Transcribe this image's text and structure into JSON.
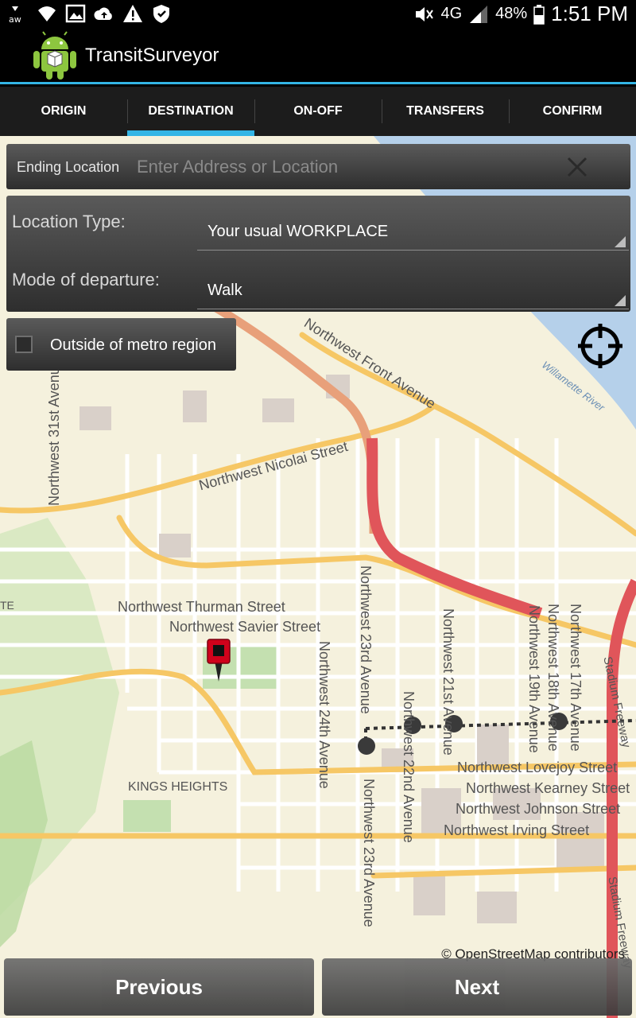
{
  "status_bar": {
    "network_label": "4G",
    "battery": "48%",
    "time": "1:51 PM"
  },
  "app": {
    "title": "TransitSurveyor"
  },
  "tabs": [
    {
      "label": "ORIGIN",
      "active": false
    },
    {
      "label": "DESTINATION",
      "active": true
    },
    {
      "label": "ON-OFF",
      "active": false
    },
    {
      "label": "TRANSFERS",
      "active": false
    },
    {
      "label": "CONFIRM",
      "active": false
    }
  ],
  "search": {
    "label": "Ending Location",
    "placeholder": "Enter Address or Location",
    "value": ""
  },
  "form": {
    "location_type_label": "Location Type:",
    "location_type_value": "Your usual WORKPLACE",
    "mode_label": "Mode of departure:",
    "mode_value": "Walk"
  },
  "metro_checkbox": {
    "label": "Outside of metro region",
    "checked": false
  },
  "map": {
    "labels": {
      "front_ave": "Northwest Front Avenue",
      "willamette": "Willamette River",
      "nw31": "Northwest 31st Avenue",
      "nicolai": "Northwest Nicolai Street",
      "thurman": "Northwest Thurman Street",
      "savier": "Northwest Savier Street",
      "nw24": "Northwest 24th Avenue",
      "nw23a": "Northwest 23rd Avenue",
      "nw23b": "Northwest 23rd Avenue",
      "nw22": "Northwest 22nd Avenue",
      "nw21": "Northwest 21st Avenue",
      "nw19": "Northwest 19th Avenue",
      "nw18": "Northwest 18th Avenue",
      "nw17": "Northwest 17th Avenue",
      "stadium1": "Stadium Freeway",
      "stadium2": "Stadium Freeway",
      "lovejoy": "Northwest Lovejoy Street",
      "kearney": "Northwest Kearney Street",
      "johnson": "Northwest Johnson Street",
      "irving": "Northwest Irving Street",
      "kings_heights": "KINGS HEIGHTS",
      "te": "TE"
    },
    "credit": "© OpenStreetMap contributors"
  },
  "buttons": {
    "previous": "Previous",
    "next": "Next"
  },
  "colors": {
    "accent": "#33b5e5",
    "marker": "#d0021b",
    "water": "#b5d0ea",
    "freeway": "#e0555a"
  }
}
